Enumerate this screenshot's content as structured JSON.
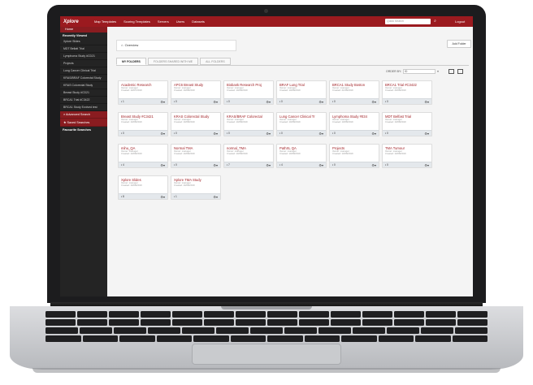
{
  "app": {
    "logo": "Xplore",
    "nav": [
      "Map Templates",
      "Scoring Templates",
      "Servers",
      "Users",
      "Datasets"
    ],
    "quick_search_placeholder": "Quick Search",
    "logout": "Logout"
  },
  "sidebar": {
    "home": "Home",
    "recently_viewed": "Recently Viewed",
    "items": [
      "Xplore Slides",
      "MDT Bellatt Trial",
      "Lymphoma Study #CD21",
      "Projects",
      "Lung Cancer Clinical Trial",
      "KRAS/BRAF Colorectal Study",
      "KRAS Colorectal Study",
      "Breast Study #CD21",
      "BRCA1 Trial #C3422",
      "BRCA1 Study Evolved test"
    ],
    "advanced_search": "Advanced Search",
    "saved_searches": "Saved Searches",
    "favourite_searches": "Favourite Searches"
  },
  "main": {
    "breadcrumb": "Overview",
    "add_folder": "Add Folder",
    "tabs": [
      "MY FOLDERS",
      "FOLDERS SHARED WITH ME",
      "ALL FOLDERS"
    ],
    "order_by_label": "ORDER BY:",
    "order_by_value": "ID",
    "owner_line": "Owner: manager",
    "folders": [
      {
        "title": "Academic Research",
        "created": "Created: 10/07/2019",
        "count": "1"
      },
      {
        "title": "APC6 Breast Study",
        "created": "Created: 10/08/2019",
        "count": "0"
      },
      {
        "title": "Biobank Research Proj",
        "created": "Created: 10/08/2019",
        "count": "0"
      },
      {
        "title": "BRAF Lung Trial",
        "created": "Created: 10/08/2019",
        "count": "0"
      },
      {
        "title": "BRCA1 Study Boston",
        "created": "Created: 21/08/2019",
        "count": "0"
      },
      {
        "title": "BRCA1 Trial #C3422",
        "created": "Created: 26/08/2019",
        "count": "0"
      },
      {
        "title": "Breast Study #C3421",
        "created": "Created: 10/08/2019",
        "count": "0"
      },
      {
        "title": "KRAS Colorectal Study",
        "created": "Created: 10/08/2019",
        "count": "0"
      },
      {
        "title": "KRAS/BRAF Colorectal",
        "created": "Created: 10/08/2019",
        "count": "0"
      },
      {
        "title": "Lung Cancer Clinical Tr",
        "created": "Created: 10/08/2019",
        "count": "0"
      },
      {
        "title": "Lymphoma Study #034",
        "created": "Created: 10/08/2019",
        "count": "0"
      },
      {
        "title": "MDT Belfast Trial",
        "created": "Created: 10/08/2019",
        "count": "0"
      },
      {
        "title": "mihu_QA",
        "created": "Created: 10/08/2019",
        "count": "4"
      },
      {
        "title": "Normal TMA",
        "created": "Created: 10/08/2019",
        "count": "0"
      },
      {
        "title": "normal_TMA",
        "created": "Created: 10/08/2019",
        "count": "7"
      },
      {
        "title": "PathXL QA",
        "created": "Created: 10/08/2019",
        "count": "4"
      },
      {
        "title": "Projects",
        "created": "Created: 10/08/2019",
        "count": "0"
      },
      {
        "title": "TMA Tumour",
        "created": "Created: 10/08/2019",
        "count": "0"
      },
      {
        "title": "Xplore Slides",
        "created": "Created: 10/08/2019",
        "count": "8"
      },
      {
        "title": "Xplore TMA Study",
        "created": "Created: 10/08/2019",
        "count": "1"
      }
    ]
  },
  "colors": {
    "accent": "#9b1a1f",
    "sidebar": "#242424"
  }
}
